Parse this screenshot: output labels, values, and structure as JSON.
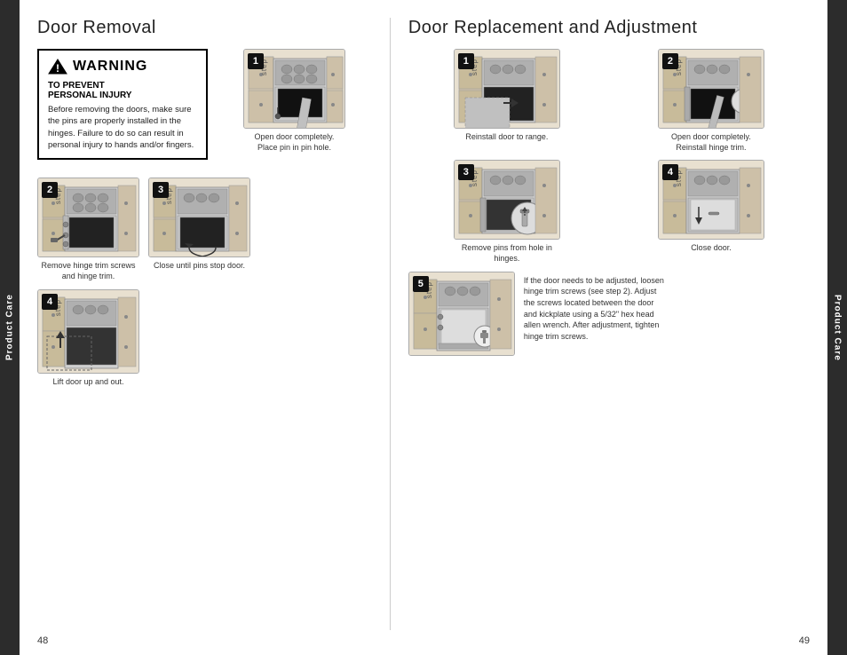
{
  "left_tab": "Product Care",
  "right_tab": "Product Care",
  "left_section": {
    "title": "Door Removal",
    "warning": {
      "header": "WARNING",
      "subtitle": "TO PREVENT\nPERSONAL INJURY",
      "text": "Before removing the doors, make sure the pins are properly installed in the hinges. Failure to do so can result in personal injury to hands and/or fingers."
    },
    "steps": [
      {
        "number": "1",
        "caption": "Open door completely.\nPlace pin in pin hole."
      },
      {
        "number": "2",
        "caption": "Remove hinge trim screws\nand hinge trim."
      },
      {
        "number": "3",
        "caption": "Close until pins stop door."
      },
      {
        "number": "4",
        "caption": "Lift door up and out."
      }
    ]
  },
  "right_section": {
    "title": "Door Replacement and Adjustment",
    "steps": [
      {
        "number": "1",
        "caption": "Reinstall door to range."
      },
      {
        "number": "2",
        "caption": "Open door completely.\nReinstall hinge trim."
      },
      {
        "number": "3",
        "caption": "Remove pins from hole in hinges."
      },
      {
        "number": "4",
        "caption": "Close door."
      },
      {
        "number": "5",
        "caption": "If the door needs to be adjusted, loosen hinge trim screws (see step 2). Adjust the screws located between the door and kickplate using a 5/32\" hex head allen wrench. After adjustment, tighten hinge trim screws."
      }
    ]
  },
  "page_numbers": {
    "left": "48",
    "right": "49"
  }
}
